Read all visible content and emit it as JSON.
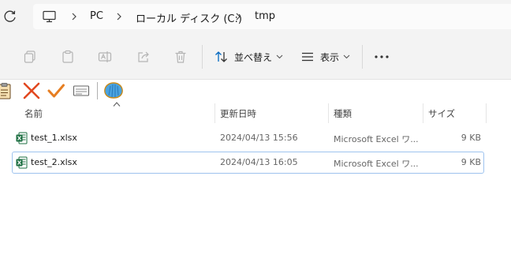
{
  "address_bar": {
    "breadcrumbs": [
      "PC",
      "ローカル ディスク (C:)",
      "tmp"
    ]
  },
  "toolbar": {
    "sort_label": "並べ替え",
    "view_label": "表示"
  },
  "file_list": {
    "columns": [
      "名前",
      "更新日時",
      "種類",
      "サイズ"
    ],
    "files": [
      {
        "name": "test_1.xlsx",
        "modified": "2024/04/13 15:56",
        "type": "Microsoft Excel ワ...",
        "size": "9 KB"
      },
      {
        "name": "test_2.xlsx",
        "modified": "2024/04/13 16:05",
        "type": "Microsoft Excel ワ...",
        "size": "9 KB"
      }
    ]
  },
  "colors": {
    "accent": "#0067c0",
    "selection_border": "#9ec3ee",
    "excel_green": "#1d6f42",
    "extension_red": "#e2481f",
    "extension_orange": "#e67e22"
  }
}
